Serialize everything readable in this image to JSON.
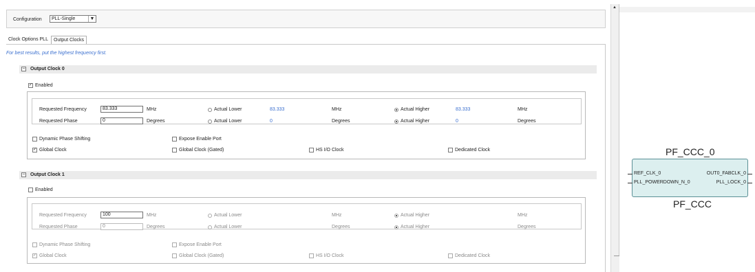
{
  "config": {
    "label": "Configuration",
    "selected": "PLL-Single"
  },
  "tabs": [
    {
      "label": "Clock Options PLL"
    },
    {
      "label": "Output Clocks"
    }
  ],
  "hint": "For best results, put the highest frequency first.",
  "clocks": [
    {
      "title": "Output Clock 0",
      "toggle": "⊟",
      "enabled_label": "Enabled",
      "enabled": true,
      "freq_label": "Requested Frequency",
      "freq_value": "83.333",
      "freq_unit": "MHz",
      "phase_label": "Requested Phase",
      "phase_value": "0",
      "phase_unit": "Degrees",
      "actual_lower_label": "Actual Lower",
      "actual_lower_freq": "83.333",
      "actual_lower_phase": "0",
      "actual_higher_label": "Actual Higher",
      "actual_higher_freq": "83.333",
      "actual_higher_phase": "0",
      "mhz": "MHz",
      "degrees": "Degrees",
      "dps_label": "Dynamic Phase Shifting",
      "expose_label": "Expose Enable Port",
      "global_label": "Global Clock",
      "global_gated_label": "Global Clock (Gated)",
      "hsio_label": "HS I/O Clock",
      "dedicated_label": "Dedicated Clock"
    },
    {
      "title": "Output Clock 1",
      "toggle": "⊟",
      "enabled_label": "Enabled",
      "enabled": false,
      "freq_label": "Requested Frequency",
      "freq_value": "100",
      "freq_unit": "MHz",
      "phase_label": "Requested Phase",
      "phase_value": "0",
      "phase_unit": "Degrees",
      "actual_lower_label": "Actual Lower",
      "actual_higher_label": "Actual Higher",
      "mhz": "MHz",
      "degrees": "Degrees",
      "dps_label": "Dynamic Phase Shifting",
      "expose_label": "Expose Enable Port",
      "global_label": "Global Clock",
      "global_gated_label": "Global Clock (Gated)",
      "hsio_label": "HS I/O Clock",
      "dedicated_label": "Dedicated Clock"
    }
  ],
  "symbol": {
    "title": "PF_CCC_0",
    "subtitle": "PF_CCC",
    "inputs": [
      "REF_CLK_0",
      "PLL_POWERDOWN_N_0"
    ],
    "outputs": [
      "OUT0_FABCLK_0",
      "PLL_LOCK_0"
    ]
  },
  "colors": {
    "link_blue": "#3a6fcf",
    "symbol_fill": "#dcefef",
    "symbol_border": "#5a8f95"
  }
}
